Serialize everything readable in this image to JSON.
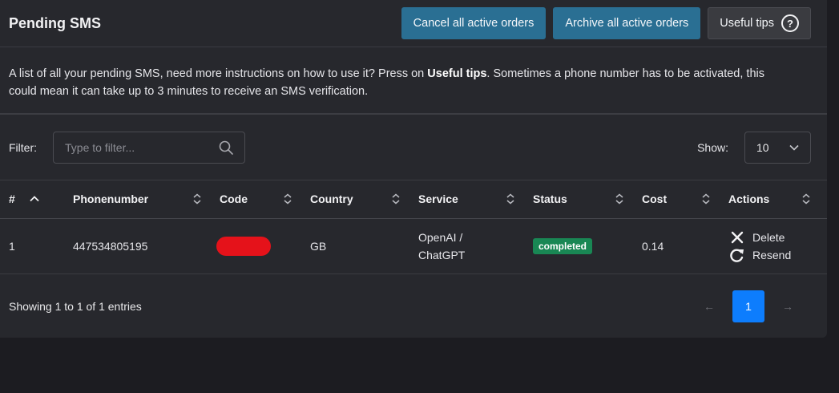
{
  "header": {
    "title": "Pending SMS",
    "cancel_label": "Cancel all active orders",
    "archive_label": "Archive all active orders",
    "tips_label": "Useful tips",
    "tips_icon": "question-circle-icon"
  },
  "description": {
    "part1": "A list of all your pending SMS, need more instructions on how to use it? Press on ",
    "bold": "Useful tips",
    "part2": ". Sometimes a phone number has to be activated, this could mean it can take up to 3 minutes to receive an SMS verification."
  },
  "filter": {
    "label": "Filter:",
    "placeholder": "Type to filter..."
  },
  "show": {
    "label": "Show:",
    "value": "10"
  },
  "table": {
    "columns": [
      "#",
      "Phonenumber",
      "Code",
      "Country",
      "Service",
      "Status",
      "Cost",
      "Actions"
    ],
    "rows": [
      {
        "num": "1",
        "phone": "447534805195",
        "code": "",
        "country": "GB",
        "service_line1": "OpenAI /",
        "service_line2": "ChatGPT",
        "status": "completed",
        "cost": "0.14",
        "delete_label": "Delete",
        "resend_label": "Resend"
      }
    ]
  },
  "footer": {
    "info": "Showing 1 to 1 of 1 entries",
    "prev": "←",
    "page": "1",
    "next": "→"
  },
  "colors": {
    "primary": "#2a6f93",
    "status_green": "#198754",
    "page_active": "#0d7dfd",
    "redaction": "#e5121a"
  }
}
